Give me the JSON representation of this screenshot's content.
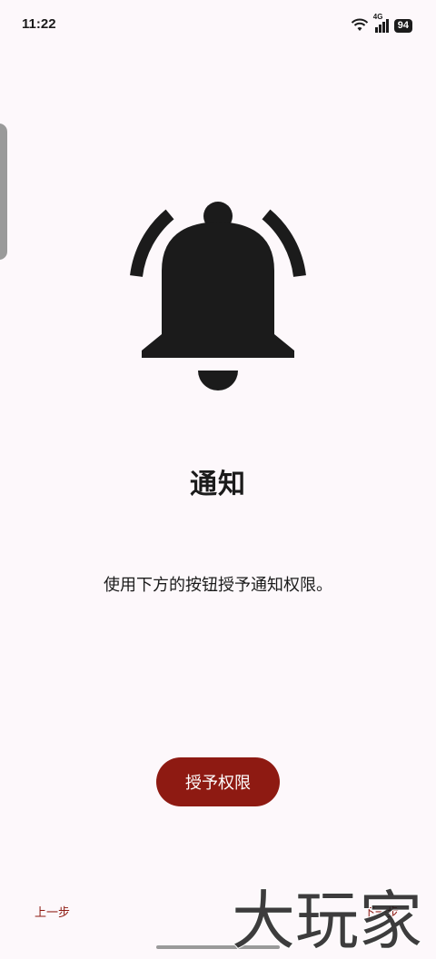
{
  "status_bar": {
    "time": "11:22",
    "network": "4G",
    "battery": "94",
    "icons": [
      "wifi-icon",
      "signal-icon",
      "battery-icon"
    ]
  },
  "main": {
    "icon": "bell-icon",
    "title": "通知",
    "description": "使用下方的按钮授予通知权限。",
    "grant_button_label": "授予权限"
  },
  "footer": {
    "prev_label": "上一步",
    "next_label": "下一步"
  },
  "watermark": {
    "text": "大玩家"
  },
  "colors": {
    "background": "#fdf8fb",
    "accent": "#8e1a12",
    "text": "#1b1b1b"
  }
}
